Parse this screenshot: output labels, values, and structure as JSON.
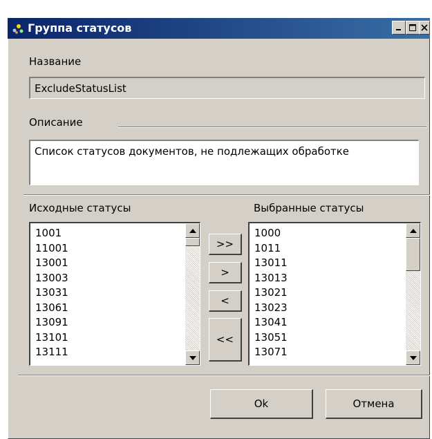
{
  "window": {
    "title": "Группа статусов"
  },
  "name_section": {
    "label": "Название",
    "value": "ExcludeStatusList"
  },
  "description_section": {
    "label": "Описание",
    "value": "Список статусов документов, не подлежащих обработке"
  },
  "source_list": {
    "label": "Исходные статусы",
    "items": [
      "1001",
      "11001",
      "13001",
      "13003",
      "13031",
      "13061",
      "13091",
      "13101",
      "13111"
    ]
  },
  "selected_list": {
    "label": "Выбранные статусы",
    "items": [
      "1000",
      "1011",
      "13011",
      "13013",
      "13021",
      "13023",
      "13041",
      "13051",
      "13071"
    ]
  },
  "transfer_buttons": {
    "add_all": ">>",
    "add": ">",
    "remove": "<",
    "remove_all": "<<"
  },
  "footer": {
    "ok_label": "Ok",
    "cancel_label": "Отмена"
  },
  "icons": {
    "title": "app-icon",
    "minimize": "minimize-icon",
    "maximize": "maximize-icon",
    "close": "close-icon",
    "scroll_up": "up-arrow-icon",
    "scroll_down": "down-arrow-icon"
  }
}
